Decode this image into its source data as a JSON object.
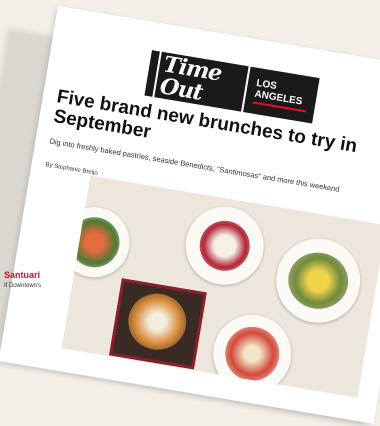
{
  "logo": {
    "brand": "Time Out",
    "city": "LOS ANGELES"
  },
  "article": {
    "headline": "Five brand new brunches to try in September",
    "dek": "Dig into freshly baked pastries, seaside Benedicts, \"Santimosas\" and more this weekend",
    "byline": "By Stephanie Breijo",
    "byline_sep": "|"
  },
  "sidebar": {
    "title": "Santuari",
    "text": "If Downtown's"
  },
  "colors": {
    "accent": "#c4122b",
    "logo_bg": "#1a1a1a"
  }
}
